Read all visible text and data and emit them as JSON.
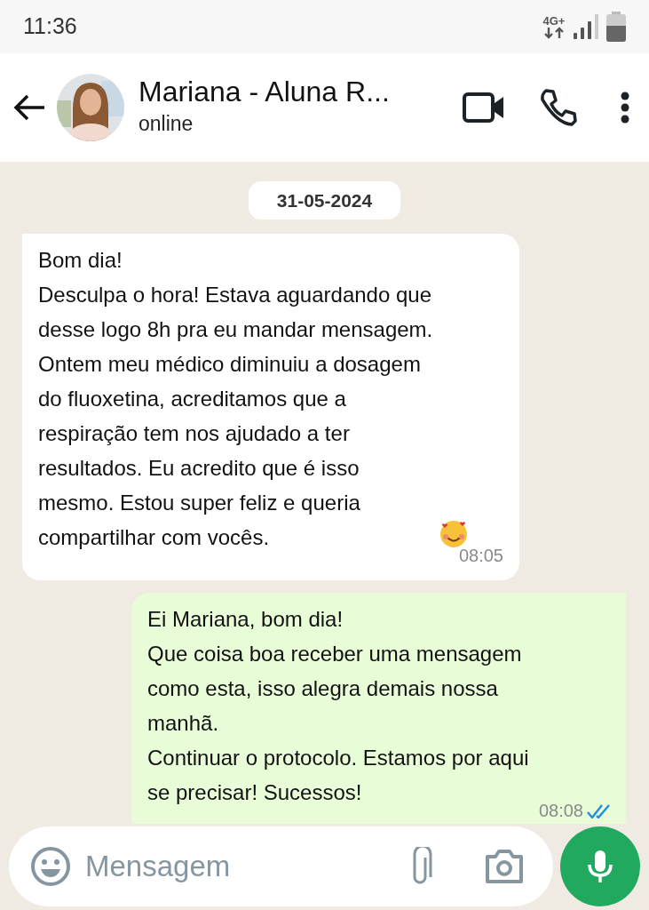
{
  "status_bar": {
    "time": "11:36",
    "network": "4G+"
  },
  "header": {
    "contact_name": "Mariana - Aluna R...",
    "presence": "online"
  },
  "date_chip": "31-05-2024",
  "messages": [
    {
      "kind": "incoming",
      "text": "Bom dia!\nDesculpa o hora! Estava aguardando que\ndesse logo 8h pra eu mandar mensagem.\nOntem meu médico diminuiu a dosagem\ndo fluoxetina, acreditamos que a\nrespiração tem nos ajudado a ter\nresultados. Eu acredito que é isso\nmesmo. Estou super feliz e queria\ncompartilhar com vocês.",
      "has_emoji": true,
      "time": "08:05"
    },
    {
      "kind": "outgoing",
      "text": "Ei Mariana, bom dia!\nQue coisa boa receber uma mensagem\ncomo esta, isso alegra demais nossa\nmanhã.\nContinuar o protocolo. Estamos por aqui\nse precisar! Sucessos!",
      "has_emoji": false,
      "time": "08:08",
      "read": true
    }
  ],
  "composer": {
    "placeholder": "Mensagem"
  }
}
